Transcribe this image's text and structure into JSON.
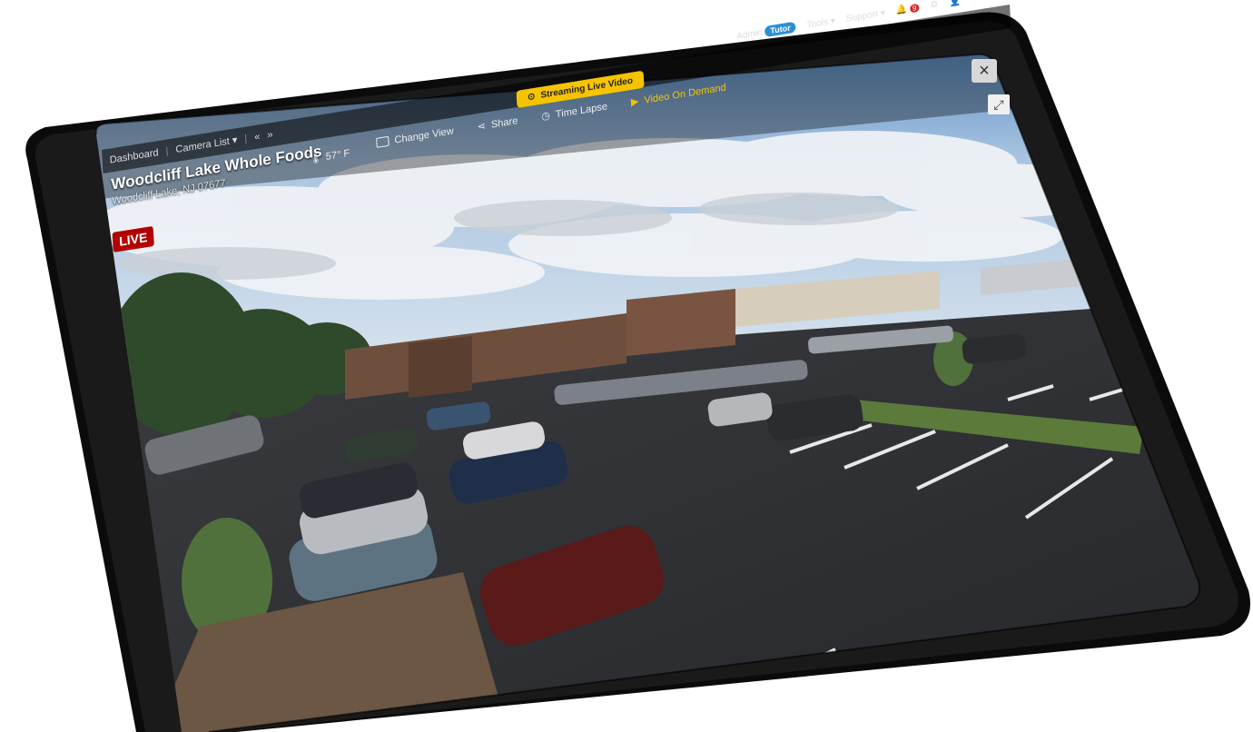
{
  "nav": {
    "breadcrumb": [
      "Dashboard",
      "Camera List ▾",
      "«",
      "»"
    ],
    "streaming_label": "Streaming Live Video",
    "admin_label": "Admin",
    "tutor_label": "Tutor",
    "tools_label": "Tools ▾",
    "support_label": "Support ▾",
    "notification_count": "9"
  },
  "camera": {
    "title": "Woodcliff Lake Whole Foods",
    "location": "Woodcliff Lake, NJ 07677",
    "temperature": "57° F",
    "live_label": "LIVE"
  },
  "toolbar": {
    "change_view": "Change View",
    "share": "Share",
    "time_lapse": "Time Lapse",
    "video_on_demand": "Video On Demand"
  },
  "colors": {
    "accent_yellow": "#f5c400",
    "live_red": "#b30000",
    "tablet_frame": "#111111"
  },
  "icons": {
    "close": "×",
    "expand": "⤢",
    "temperature": "thermometer-icon",
    "share": "share-icon",
    "time_lapse": "clock-icon",
    "vod": "video-camera-icon"
  }
}
